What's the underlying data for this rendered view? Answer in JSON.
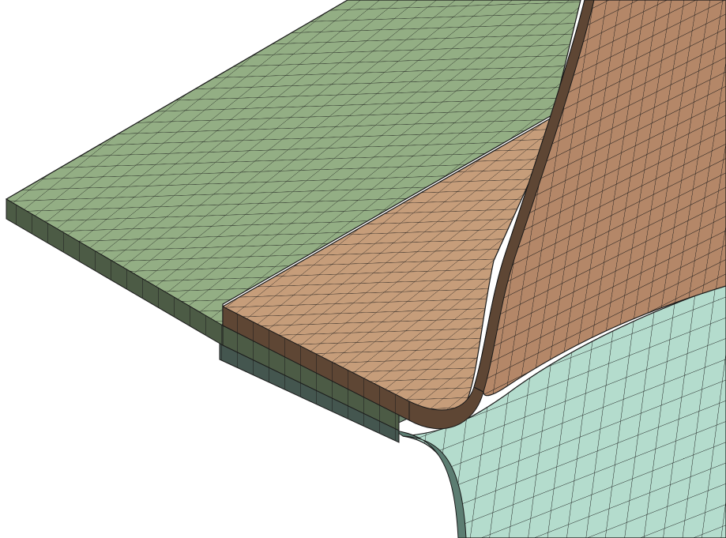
{
  "scene": {
    "background": "#ffffff",
    "mesh_edge_color": "#1a1a1a",
    "parts": [
      {
        "name": "base-plate",
        "color_top": "#93ae84",
        "color_edge": "#4c5b45"
      },
      {
        "name": "lower-plate",
        "color_top": "#6f8772",
        "color_edge": "#44564f"
      },
      {
        "name": "angle-bracket",
        "color_top": "#c69d7a",
        "color_wall": "#b48768",
        "color_edge": "#5e4634"
      },
      {
        "name": "curved-support",
        "color_top": "#b4dccd",
        "color_edge": "#5c7d72"
      }
    ]
  }
}
